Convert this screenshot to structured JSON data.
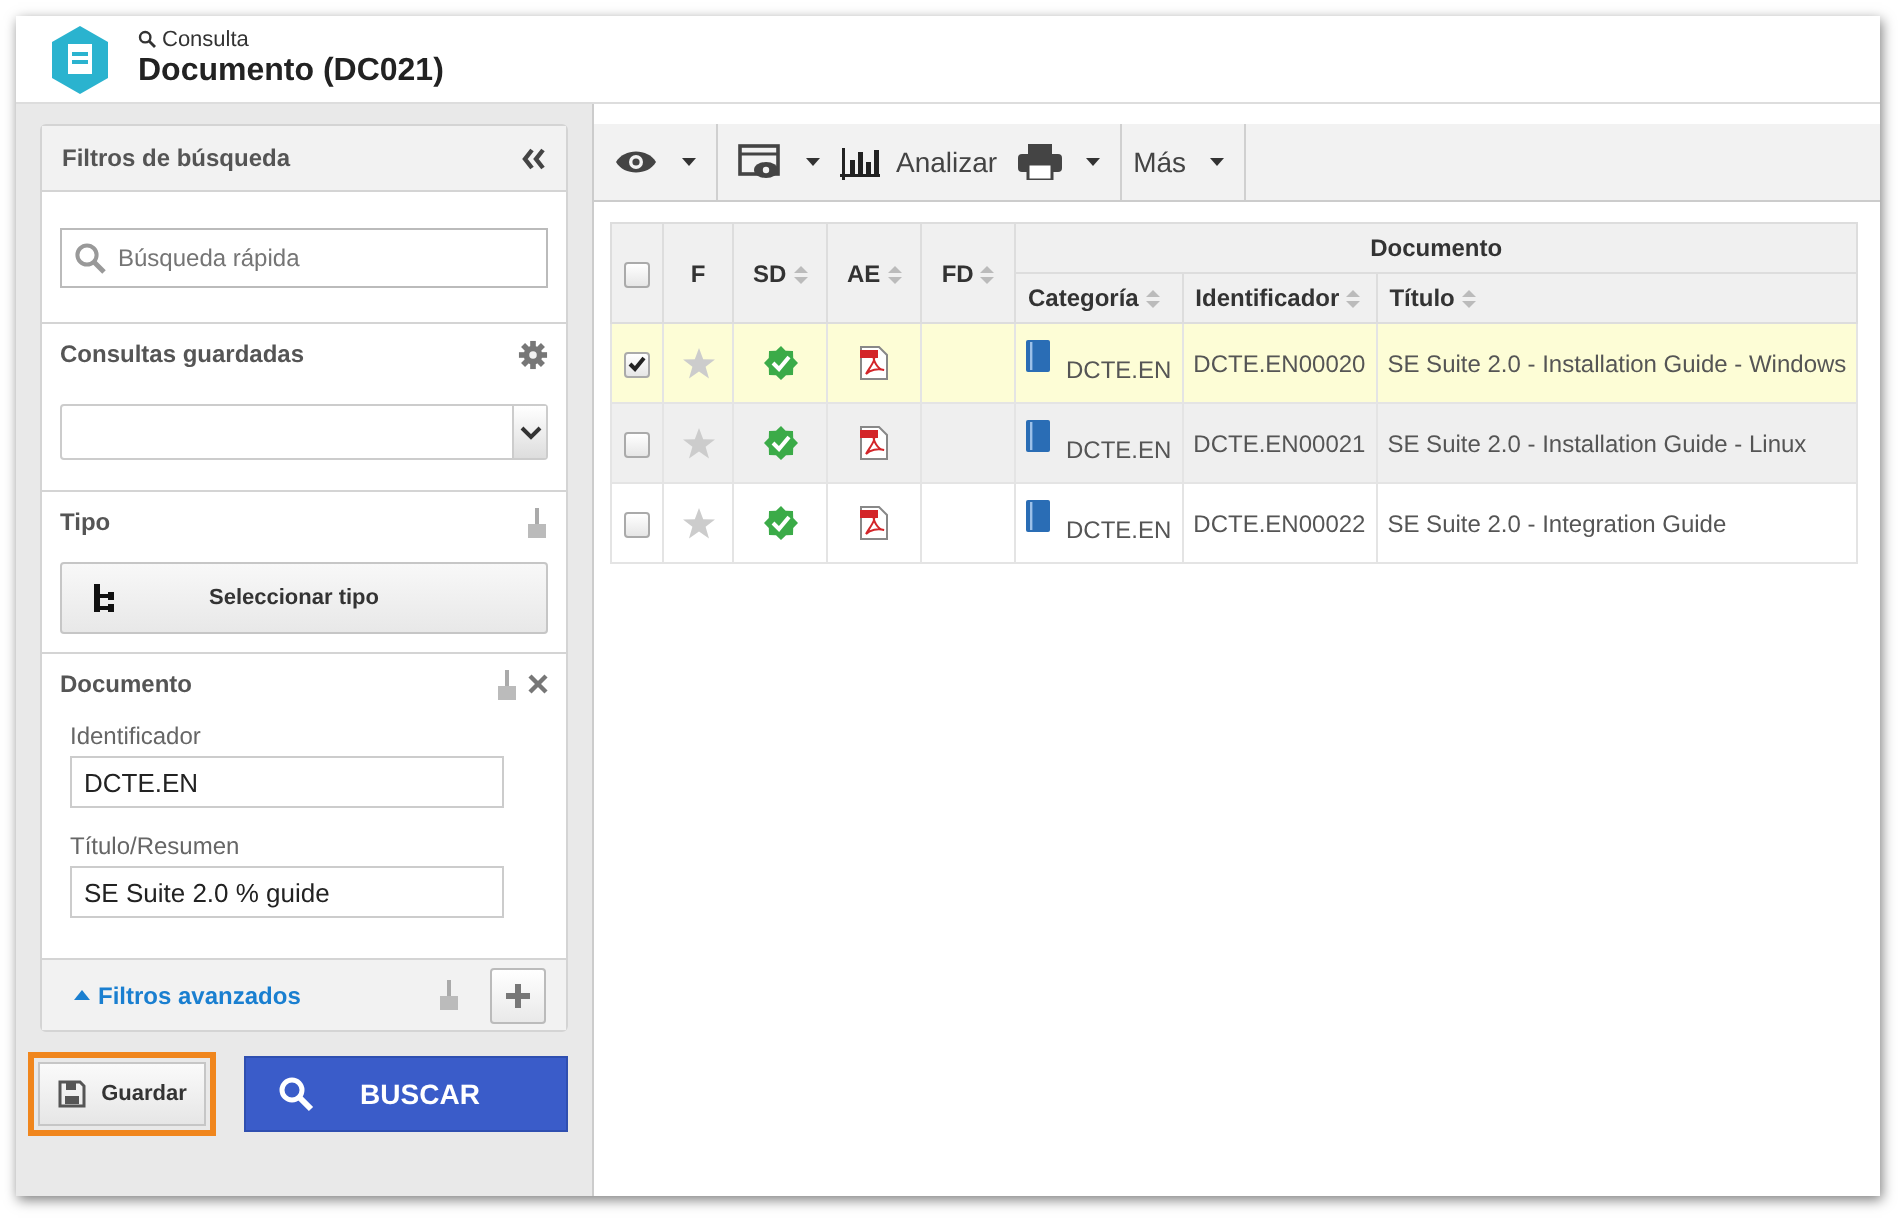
{
  "header": {
    "breadcrumb": "Consulta",
    "title": "Documento (DC021)"
  },
  "filters": {
    "title": "Filtros de búsqueda",
    "quick_search": {
      "placeholder": "Búsqueda rápida"
    },
    "saved_queries": {
      "label": "Consultas guardadas"
    },
    "type": {
      "label": "Tipo",
      "button": "Seleccionar tipo"
    },
    "document": {
      "label": "Documento",
      "fields": [
        {
          "label": "Identificador",
          "value": "DCTE.EN"
        },
        {
          "label": "Título/Resumen",
          "value": "SE Suite 2.0 % guide"
        }
      ]
    },
    "advanced": {
      "label": "Filtros avanzados",
      "expanded": true
    }
  },
  "buttons": {
    "save": "Guardar",
    "search": "BUSCAR"
  },
  "toolbar": [
    {
      "kind": "eye",
      "caret": true
    },
    {
      "kind": "view",
      "caret": true
    },
    {
      "kind": "chart",
      "label": "Analizar"
    },
    {
      "kind": "print",
      "caret": true
    },
    {
      "kind": "text",
      "label": "Más",
      "caret": true
    }
  ],
  "table": {
    "all_checked": false,
    "group": "Documento",
    "columns": [
      "F",
      "SD",
      "AE",
      "FD"
    ],
    "group_columns": [
      "Categoría",
      "Identificador",
      "Título"
    ],
    "rows": [
      {
        "checked": true,
        "selected": true,
        "category": "DCTE.EN",
        "identifier": "DCTE.EN00020",
        "title": "SE Suite 2.0 - Installation Guide - Windows"
      },
      {
        "checked": false,
        "selected": false,
        "category": "DCTE.EN",
        "identifier": "DCTE.EN00021",
        "title": "SE Suite 2.0 - Installation Guide - Linux"
      },
      {
        "checked": false,
        "selected": false,
        "category": "DCTE.EN",
        "identifier": "DCTE.EN00022",
        "title": "SE Suite 2.0 - Integration Guide"
      }
    ]
  }
}
